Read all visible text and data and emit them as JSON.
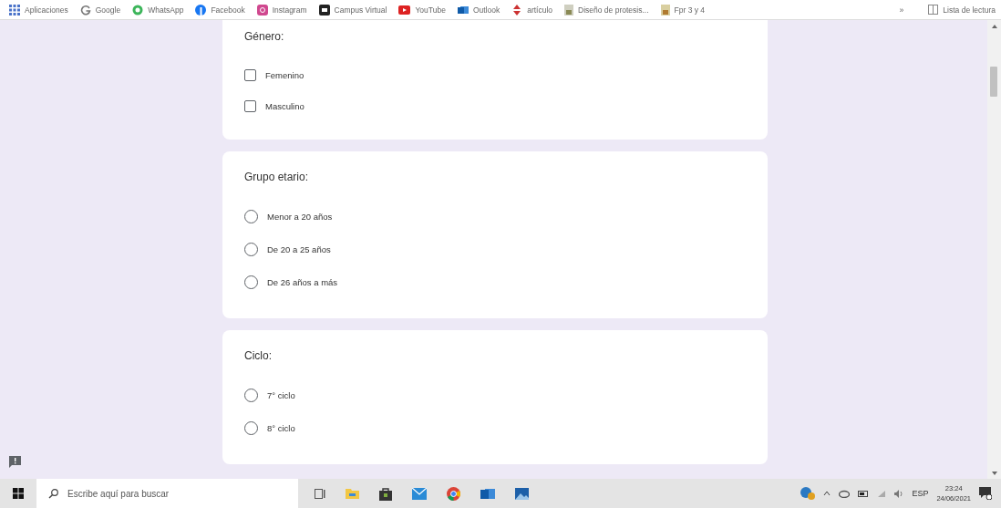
{
  "bookmarks": [
    {
      "label": "Aplicaciones"
    },
    {
      "label": "Google"
    },
    {
      "label": "WhatsApp"
    },
    {
      "label": "Facebook"
    },
    {
      "label": "Instagram"
    },
    {
      "label": "Campus Virtual"
    },
    {
      "label": "YouTube"
    },
    {
      "label": "Outlook"
    },
    {
      "label": "artículo"
    },
    {
      "label": "Diseño de protesis..."
    },
    {
      "label": "Fpr 3 y 4"
    }
  ],
  "bookmarks_overflow": "»",
  "reading_list": "Lista de lectura",
  "questions": [
    {
      "title": "Género:",
      "kind": "checkbox",
      "options": [
        {
          "label": "Femenino",
          "checked": false
        },
        {
          "label": "Masculino",
          "checked": false
        }
      ]
    },
    {
      "title": "Grupo etario:",
      "kind": "radio",
      "options": [
        {
          "label": "Menor a 20 años",
          "selected": false
        },
        {
          "label": "De 20 a 25 años",
          "selected": false
        },
        {
          "label": "De 26 años a más",
          "selected": false
        }
      ]
    },
    {
      "title": "Ciclo:",
      "kind": "radio",
      "options": [
        {
          "label": "7° ciclo",
          "selected": false
        },
        {
          "label": "8° ciclo",
          "selected": false
        }
      ]
    }
  ],
  "taskbar": {
    "search_placeholder": "Escribe aquí para buscar",
    "language": "ESP",
    "time": "23:24",
    "date": "24/06/2021"
  }
}
